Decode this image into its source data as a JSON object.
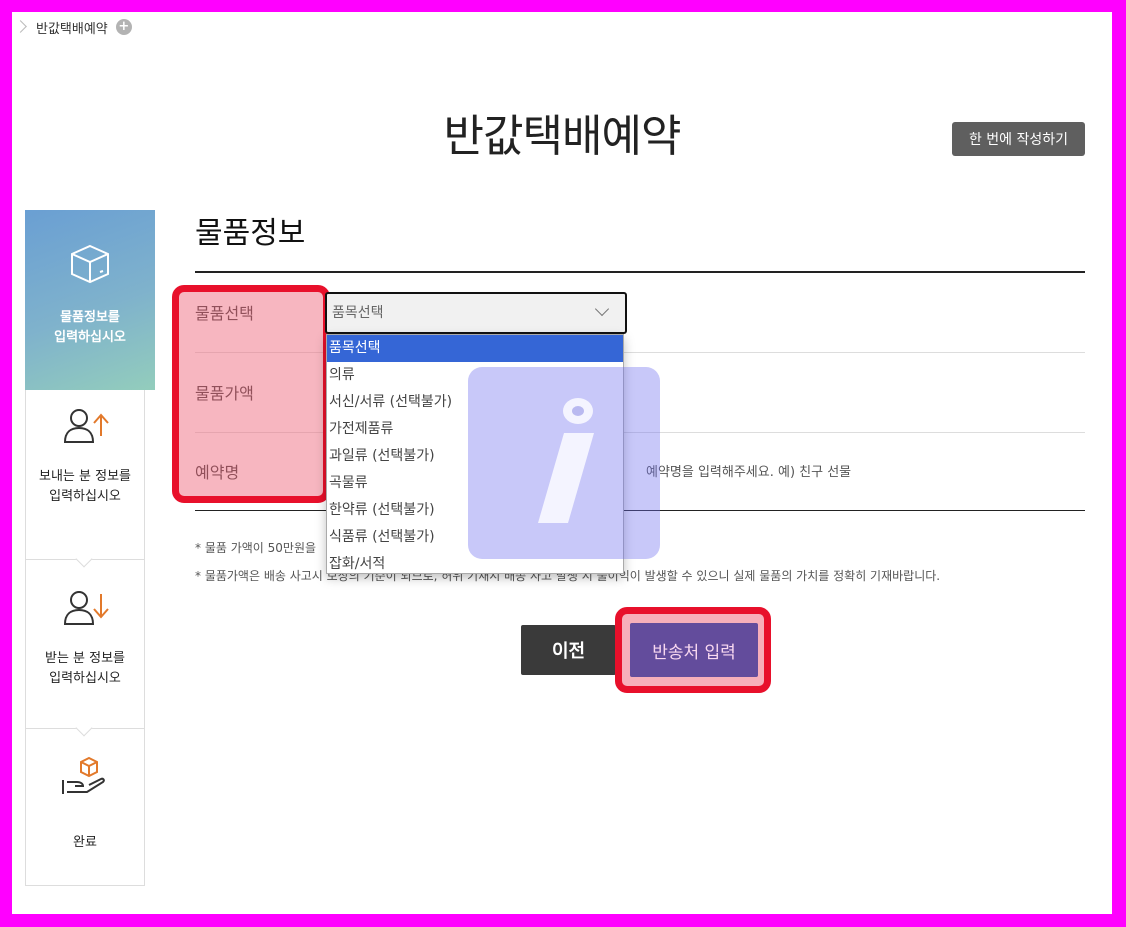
{
  "breadcrumb": {
    "current": "반값택배예약"
  },
  "page": {
    "title": "반값택배예약",
    "write_once_label": "한 번에 작성하기"
  },
  "steps": [
    {
      "label_line1": "물품정보를",
      "label_line2": "입력하십시오",
      "icon": "box-icon"
    },
    {
      "label_line1": "보내는 분 정보를",
      "label_line2": "입력하십시오",
      "icon": "person-upload-icon"
    },
    {
      "label_line1": "받는 분 정보를",
      "label_line2": "입력하십시오",
      "icon": "person-download-icon"
    },
    {
      "label_line1": "완료",
      "label_line2": "",
      "icon": "hand-box-icon"
    }
  ],
  "section": {
    "title": "물품정보",
    "rows": {
      "item_select": "물품선택",
      "item_value": "물품가액",
      "reservation_name": "예약명"
    }
  },
  "select": {
    "value": "품목선택",
    "options": [
      "품목선택",
      "의류",
      "서신/서류 (선택불가)",
      "가전제품류",
      "과일류 (선택불가)",
      "곡물류",
      "한약류 (선택불가)",
      "식품류 (선택불가)",
      "잡화/서적"
    ]
  },
  "reservation_placeholder": "예약명을 입력해주세요. 예) 친구 선물",
  "notes": {
    "line1": "* 물품 가액이 50만원을",
    "line2": "* 물품가액은 배송 사고시 보상의 기준이 되므로, 허위 기재시 배송 사고 발생 시 불이익이 발생할 수 있으니 실제 물품의 가치를 정확히 기재바랍니다."
  },
  "buttons": {
    "prev": "이전",
    "next": "반송처 입력"
  },
  "colors": {
    "highlight": "#e8102b",
    "next_button": "#634c9c",
    "selected_option": "#3566d6"
  }
}
